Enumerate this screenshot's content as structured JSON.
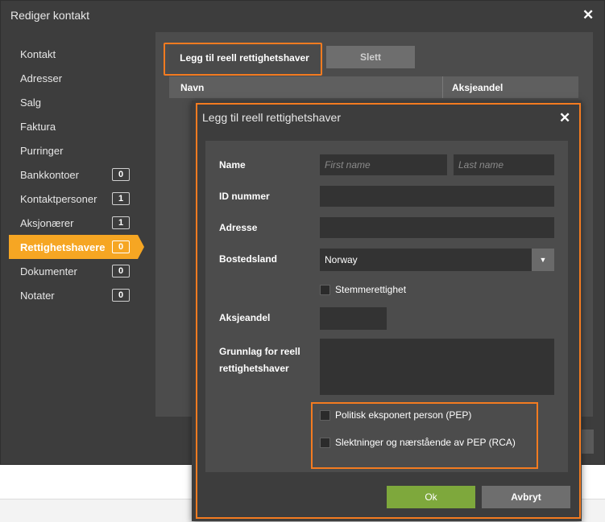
{
  "outer_dialog": {
    "title": "Rediger kontakt",
    "close_glyph": "✕"
  },
  "sidebar": {
    "items": [
      {
        "label": "Kontakt"
      },
      {
        "label": "Adresser"
      },
      {
        "label": "Salg"
      },
      {
        "label": "Faktura"
      },
      {
        "label": "Purringer"
      },
      {
        "label": "Bankkontoer",
        "count": "0"
      },
      {
        "label": "Kontaktpersoner",
        "count": "1"
      },
      {
        "label": "Aksjonærer",
        "count": "1"
      },
      {
        "label": "Rettighetshavere",
        "count": "0",
        "active": true
      },
      {
        "label": "Dokumenter",
        "count": "0"
      },
      {
        "label": "Notater",
        "count": "0"
      }
    ]
  },
  "toolbar": {
    "add_label": "Legg til reell rettighetshaver",
    "delete_label": "Slett"
  },
  "table": {
    "columns": [
      "Navn",
      "Aksjeandel"
    ]
  },
  "modal": {
    "title": "Legg til reell rettighetshaver",
    "close_glyph": "✕",
    "fields": {
      "name_label": "Name",
      "first_name_placeholder": "First name",
      "last_name_placeholder": "Last name",
      "id_label": "ID nummer",
      "address_label": "Adresse",
      "country_label": "Bostedsland",
      "country_value": "Norway",
      "voting_label": "Stemmerettighet",
      "share_label": "Aksjeandel",
      "basis_label_line1": "Grunnlag for reell",
      "basis_label_line2": "rettighetshaver",
      "pep_label": "Politisk eksponert person (PEP)",
      "rca_label": "Slektninger og nærstående av PEP (RCA)"
    },
    "ok_label": "Ok",
    "cancel_label": "Avbryt"
  },
  "colors": {
    "accent_orange": "#f47b20",
    "active_tab": "#f6a623",
    "ok_green": "#7ea83c"
  }
}
